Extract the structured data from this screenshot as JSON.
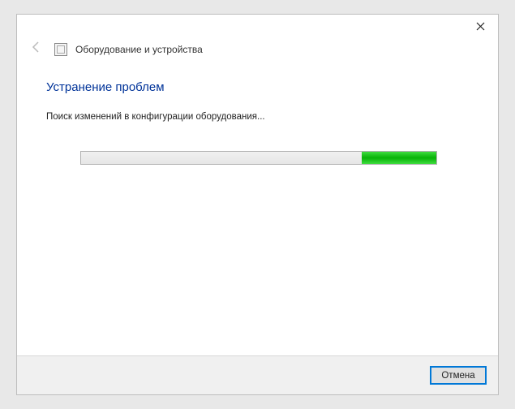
{
  "header": {
    "title": "Оборудование и устройства"
  },
  "content": {
    "heading": "Устранение проблем",
    "status": "Поиск изменений в конфигурации оборудования..."
  },
  "footer": {
    "cancel_label": "Отмена"
  }
}
